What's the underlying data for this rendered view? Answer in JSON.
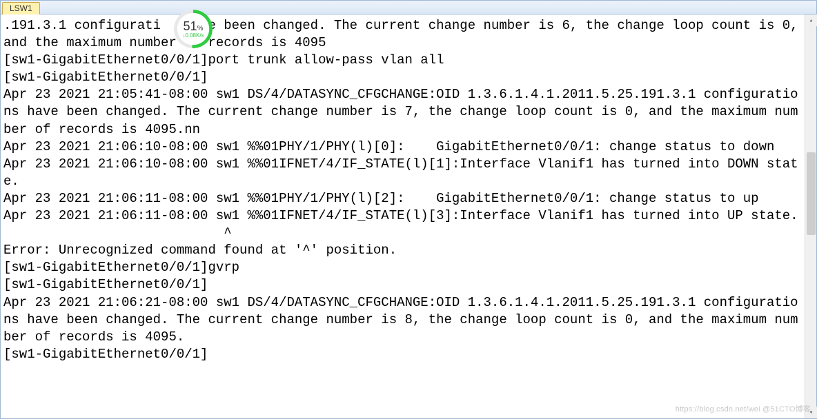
{
  "tab": {
    "label": "LSW1"
  },
  "gauge": {
    "percent": "51",
    "unit": "%",
    "rate": "↓0.08K/s"
  },
  "terminal": {
    "text": ".191.3.1 configurati   have been changed. The current change number is 6, the change loop count is 0, and the maximum number of records is 4095\n[sw1-GigabitEthernet0/0/1]port trunk allow-pass vlan all\n[sw1-GigabitEthernet0/0/1]\nApr 23 2021 21:05:41-08:00 sw1 DS/4/DATASYNC_CFGCHANGE:OID 1.3.6.1.4.1.2011.5.25.191.3.1 configurations have been changed. The current change number is 7, the change loop count is 0, and the maximum number of records is 4095.nn\nApr 23 2021 21:06:10-08:00 sw1 %%01PHY/1/PHY(l)[0]:    GigabitEthernet0/0/1: change status to down\nApr 23 2021 21:06:10-08:00 sw1 %%01IFNET/4/IF_STATE(l)[1]:Interface Vlanif1 has turned into DOWN state.\nApr 23 2021 21:06:11-08:00 sw1 %%01PHY/1/PHY(l)[2]:    GigabitEthernet0/0/1: change status to up\nApr 23 2021 21:06:11-08:00 sw1 %%01IFNET/4/IF_STATE(l)[3]:Interface Vlanif1 has turned into UP state.\n                            ^\nError: Unrecognized command found at '^' position.\n[sw1-GigabitEthernet0/0/1]gvrp\n[sw1-GigabitEthernet0/0/1]\nApr 23 2021 21:06:21-08:00 sw1 DS/4/DATASYNC_CFGCHANGE:OID 1.3.6.1.4.1.2011.5.25.191.3.1 configurations have been changed. The current change number is 8, the change loop count is 0, and the maximum number of records is 4095.\n[sw1-GigabitEthernet0/0/1]"
  },
  "watermark": "https://blog.csdn.net/wei @51CTO博客"
}
